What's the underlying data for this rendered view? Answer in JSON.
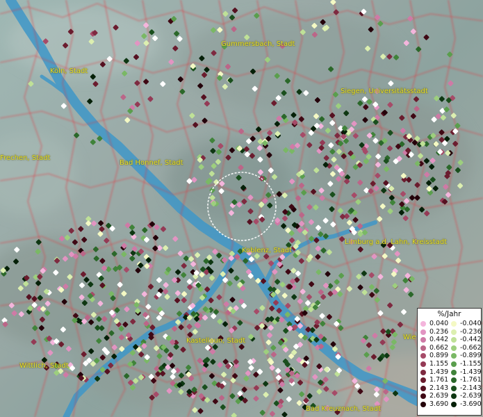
{
  "map": {
    "cities": [
      {
        "name": "Köln, Stadt"
      },
      {
        "name": "Gummersbach, Stadt"
      },
      {
        "name": "Siegen, Universitätsstadt"
      },
      {
        "name": "Frechen, Stadt"
      },
      {
        "name": "Bad Honnef, Stadt"
      },
      {
        "name": "Koblenz, Stadt"
      },
      {
        "name": "Limburg a.d. Lahn, Kreisstadt"
      },
      {
        "name": "Kastellaun, Stadt"
      },
      {
        "name": "Wittlich, Stadt"
      },
      {
        "name": "Bad Kreuznach, Stadt"
      },
      {
        "name": "Wie"
      }
    ],
    "colors": {
      "rivers": "#3f97c8",
      "borders": "#e3353c",
      "label_text": "#e8e22a",
      "selection_circle": "#ffffff"
    }
  },
  "legend": {
    "title": "%/Jahr",
    "positive": [
      {
        "label": "0.040",
        "color": "#f4b5dc"
      },
      {
        "label": "0.236",
        "color": "#e294c2"
      },
      {
        "label": "0.442",
        "color": "#cf7aa6"
      },
      {
        "label": "0.662",
        "color": "#bb6688"
      },
      {
        "label": "0.899",
        "color": "#a64b68"
      },
      {
        "label": "1.155",
        "color": "#943a55"
      },
      {
        "label": "1.439",
        "color": "#7e2a40"
      },
      {
        "label": "1.761",
        "color": "#6b1c2e"
      },
      {
        "label": "2.143",
        "color": "#561121"
      },
      {
        "label": "2.639",
        "color": "#3f0814"
      },
      {
        "label": "3.690",
        "color": "#24020a"
      }
    ],
    "negative": [
      {
        "label": "-0.040",
        "color": "#f4f9c4"
      },
      {
        "label": "-0.236",
        "color": "#dcefb0"
      },
      {
        "label": "-0.442",
        "color": "#bfe197"
      },
      {
        "label": "-0.662",
        "color": "#9dcf7e"
      },
      {
        "label": "-0.899",
        "color": "#7ab865"
      },
      {
        "label": "-1.155",
        "color": "#5a9e4d"
      },
      {
        "label": "-1.439",
        "color": "#40833a"
      },
      {
        "label": "-1.761",
        "color": "#2b682a"
      },
      {
        "label": "-2.143",
        "color": "#1a4f1d"
      },
      {
        "label": "-2.639",
        "color": "#0e3712"
      },
      {
        "label": "-3.690",
        "color": "#052008"
      }
    ]
  }
}
